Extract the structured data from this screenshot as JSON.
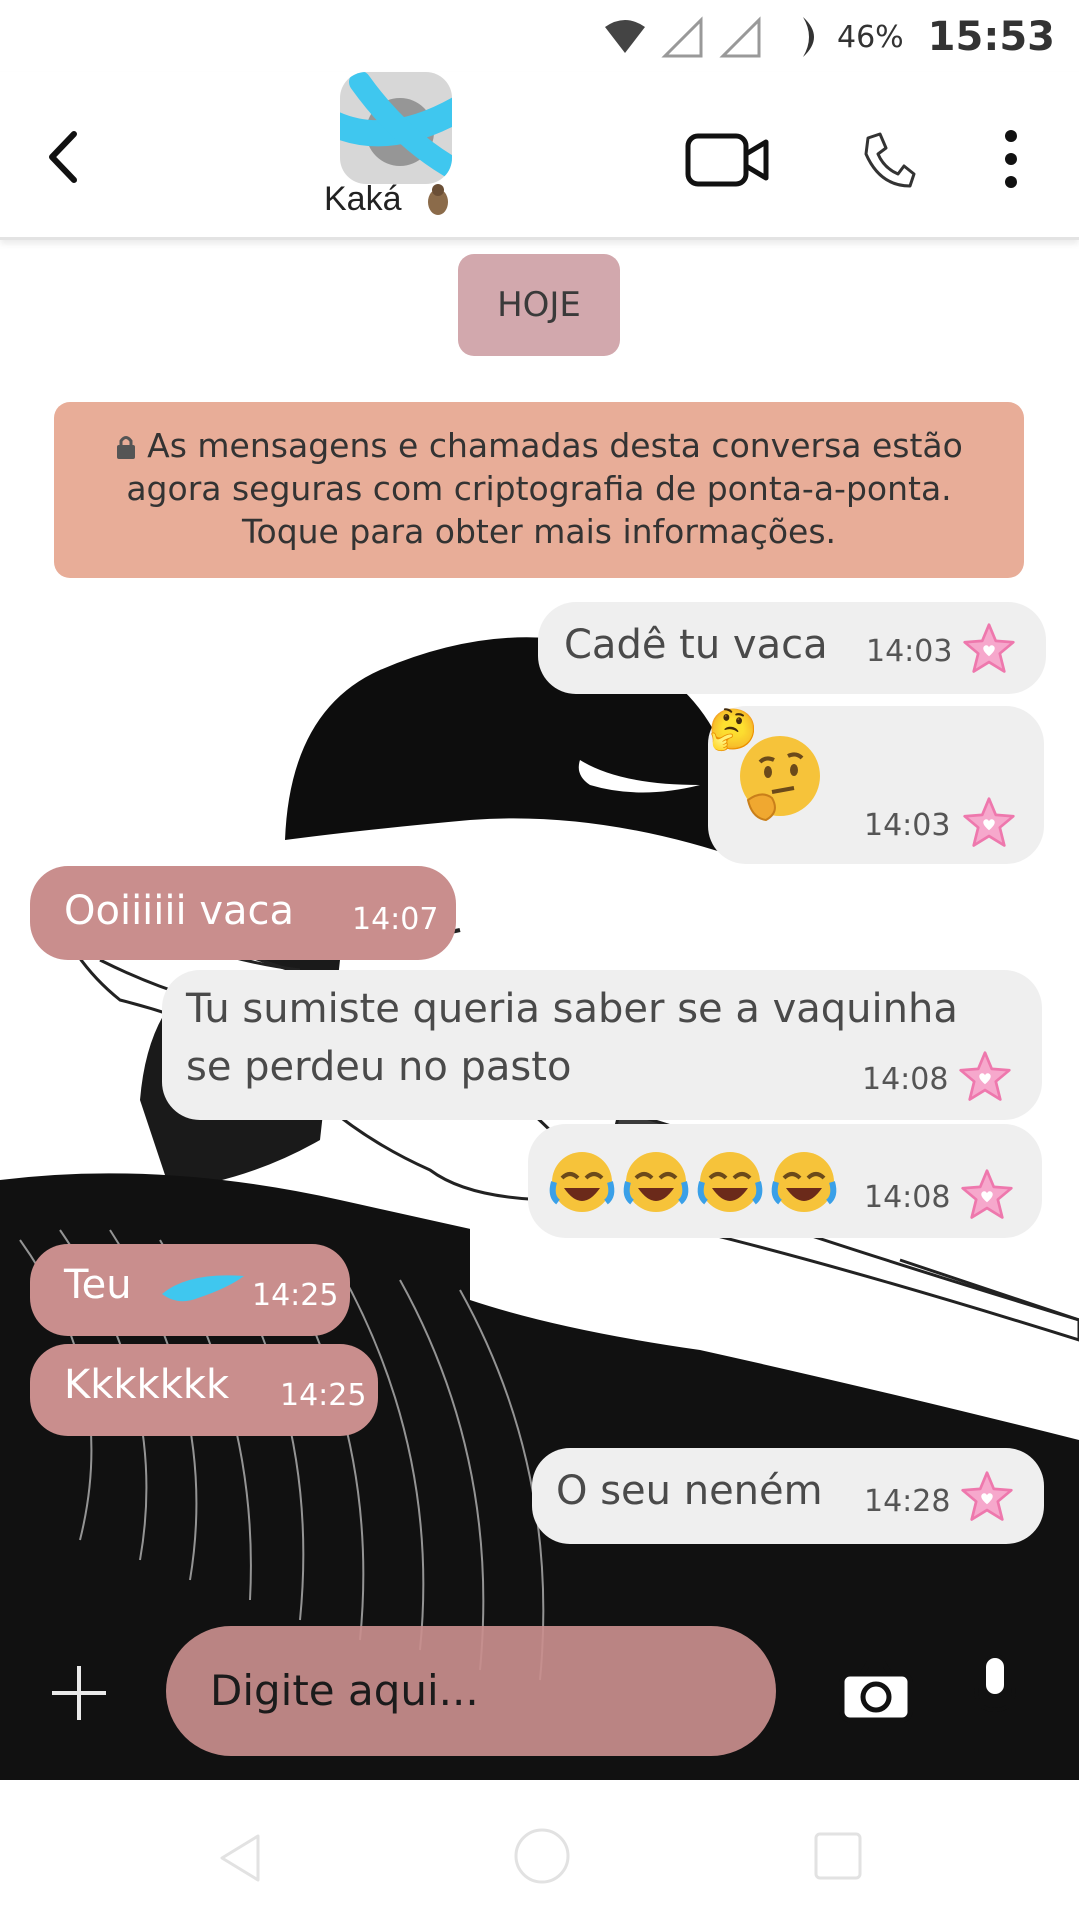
{
  "status_bar": {
    "battery": "46%",
    "time": "15:53"
  },
  "header": {
    "contact_name": "Kaká",
    "icons": [
      "back-arrow-icon",
      "video-camera-icon",
      "phone-icon",
      "more-vertical-icon"
    ]
  },
  "chat": {
    "date_chip": "HOJE",
    "encryption_notice": {
      "line1": "As mensagens e chamadas desta conversa estão",
      "line2": "agora seguras com criptografia de ponta-a-ponta.",
      "line3": "Toque para obter mais informações."
    },
    "messages": [
      {
        "direction": "out",
        "text": "Cadê tu vaca",
        "time": "14:03"
      },
      {
        "direction": "out",
        "text": "🤔",
        "time": "14:03"
      },
      {
        "direction": "in",
        "text": "Ooiiiiii vaca",
        "time": "14:07"
      },
      {
        "direction": "out",
        "line1": "Tu sumiste queria saber se a vaquinha",
        "line2": "se perdeu no pasto",
        "time": "14:08"
      },
      {
        "direction": "out",
        "text": "😂😂😂😂",
        "time": "14:08"
      },
      {
        "direction": "in",
        "text": "Teu",
        "time": "14:25"
      },
      {
        "direction": "in",
        "text": "Kkkkkkk",
        "time": "14:25"
      },
      {
        "direction": "out",
        "text": "O seu neném",
        "time": "14:28"
      }
    ]
  },
  "input": {
    "placeholder": "Digite aqui..."
  },
  "colors": {
    "incoming_bubble": "#c98e8d",
    "outgoing_bubble": "#efefef",
    "date_chip": "#d2a8ad",
    "encryption_banner": "#e8ad98",
    "star_accent": "#f08ab8"
  }
}
